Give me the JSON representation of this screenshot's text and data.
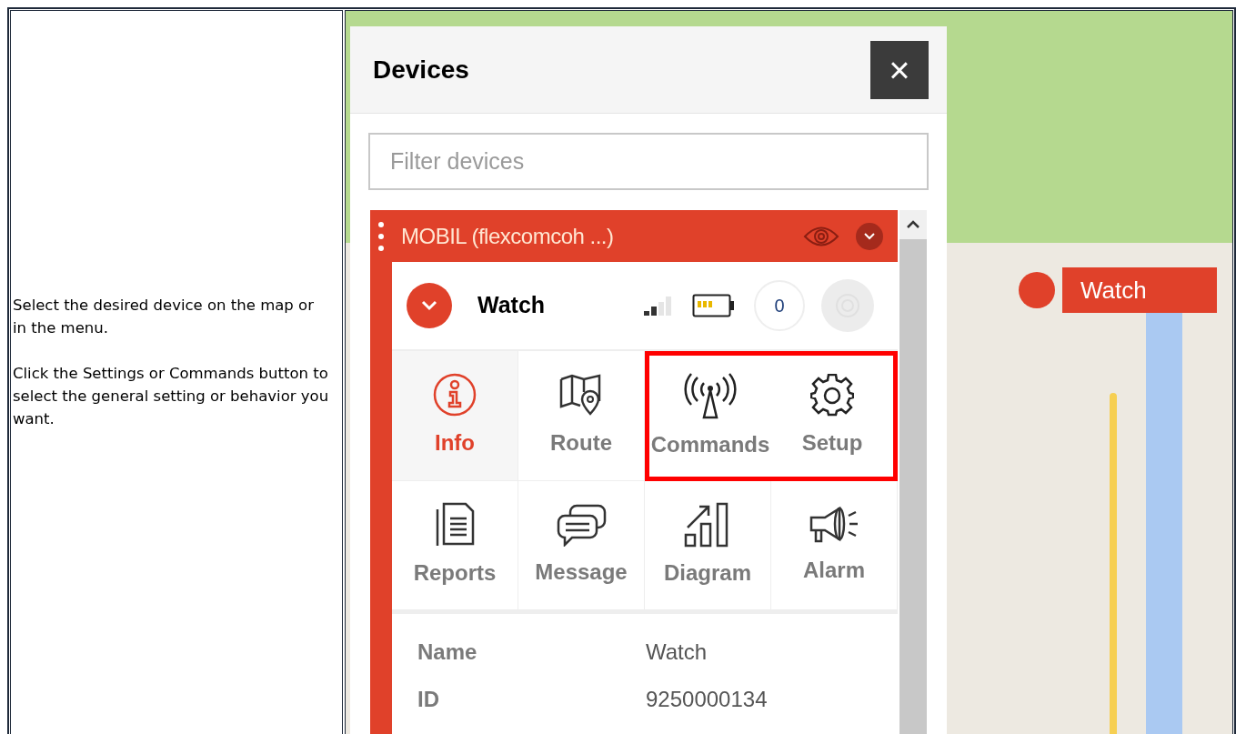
{
  "instructions": {
    "paragraphs": [
      "Select the desired device on the map or in the menu.",
      "Click the Settings or Commands button to select the general setting or behavior you want."
    ]
  },
  "devices_panel": {
    "title": "Devices",
    "close": "×",
    "filter": {
      "placeholder": "Filter devices"
    },
    "group": {
      "name": "MOBIL (flexcomcoh ...)",
      "expanded": true
    },
    "device": {
      "name": "Watch",
      "expanded": true,
      "count": "0"
    },
    "tiles": [
      {
        "kind": "info",
        "label": "Info",
        "selected": true,
        "highlighted": false
      },
      {
        "kind": "route",
        "label": "Route",
        "selected": false,
        "highlighted": false
      },
      {
        "kind": "commands",
        "label": "Commands",
        "selected": false,
        "highlighted": true
      },
      {
        "kind": "setup",
        "label": "Setup",
        "selected": false,
        "highlighted": true
      },
      {
        "kind": "reports",
        "label": "Reports",
        "selected": false,
        "highlighted": false
      },
      {
        "kind": "message",
        "label": "Message",
        "selected": false,
        "highlighted": false
      },
      {
        "kind": "diagram",
        "label": "Diagram",
        "selected": false,
        "highlighted": false
      },
      {
        "kind": "alarm",
        "label": "Alarm",
        "selected": false,
        "highlighted": false
      }
    ],
    "details": [
      {
        "label": "Name",
        "value": "Watch"
      },
      {
        "label": "ID",
        "value": "9250000134"
      }
    ]
  },
  "map": {
    "marker": {
      "label": "Watch"
    }
  }
}
